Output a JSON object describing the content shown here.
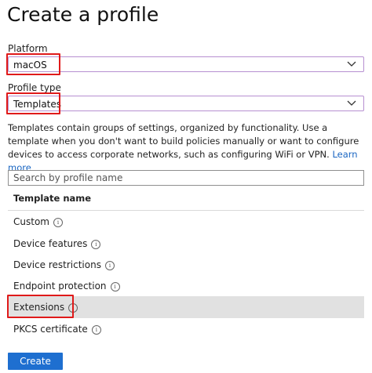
{
  "page": {
    "title": "Create a profile"
  },
  "platform": {
    "label": "Platform",
    "value": "macOS"
  },
  "profile_type": {
    "label": "Profile type",
    "value": "Templates"
  },
  "description": {
    "text": "Templates contain groups of settings, organized by functionality. Use a template when you don't want to build policies manually or want to configure devices to access corporate networks, such as configuring WiFi or VPN.",
    "link": "Learn more"
  },
  "search": {
    "placeholder": "Search by profile name"
  },
  "table": {
    "header": "Template name",
    "rows": [
      {
        "label": "Custom",
        "selected": false
      },
      {
        "label": "Device features",
        "selected": false
      },
      {
        "label": "Device restrictions",
        "selected": false
      },
      {
        "label": "Endpoint protection",
        "selected": false
      },
      {
        "label": "Extensions",
        "selected": true
      },
      {
        "label": "PKCS certificate",
        "selected": false
      }
    ]
  },
  "actions": {
    "create": "Create"
  },
  "colors": {
    "accent": "#1e6fd0",
    "highlight": "#e01a1a",
    "link": "#1a66c2",
    "select_border": "#b78fd1",
    "selected_row": "#e1e1e1"
  },
  "icons": {
    "dropdown": "chevron-down-icon",
    "info": "info-icon"
  }
}
